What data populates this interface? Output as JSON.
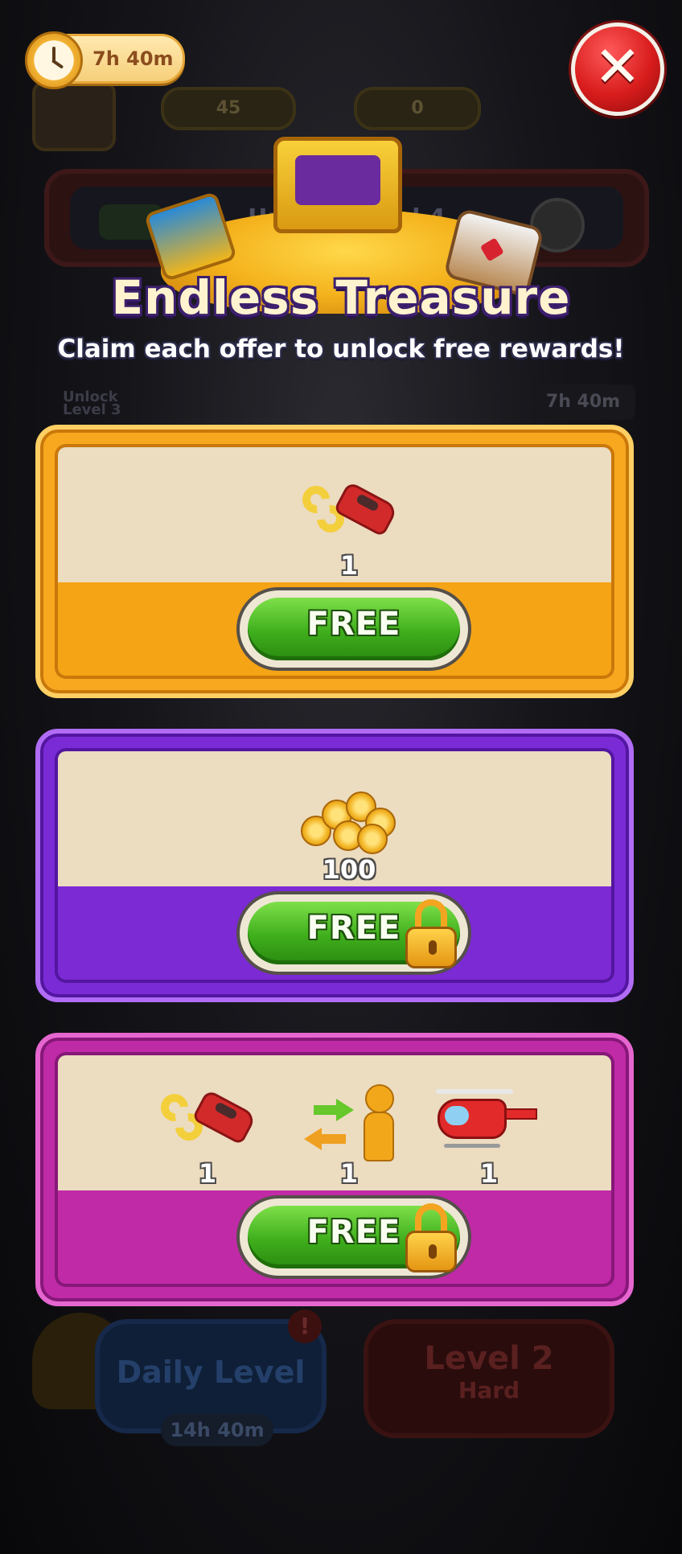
{
  "hud": {
    "timer_text": "7h 40m",
    "close_icon": "close-x-icon"
  },
  "background": {
    "coins": "45",
    "crowns": "0",
    "unlock_level_banner": "Unlock Level 4",
    "unlock_level_small": "Unlock Level 3",
    "event_timer": "7h 40m",
    "daily_level_label": "Daily Level",
    "daily_level_timer": "14h 40m",
    "daily_alert": "!",
    "level_button_title": "Level 2",
    "level_button_difficulty": "Hard"
  },
  "offer": {
    "title": "Endless Treasure",
    "subtitle": "Claim each offer to unlock free rewards!"
  },
  "cards": [
    {
      "theme": "orange",
      "accent": "#f7a81f",
      "locked": false,
      "button_label": "FREE",
      "rewards": [
        {
          "icon": "car-swap-icon",
          "count": "1"
        }
      ]
    },
    {
      "theme": "purple",
      "accent": "#7b2bd6",
      "locked": true,
      "button_label": "FREE",
      "rewards": [
        {
          "icon": "coins-icon",
          "count": "100"
        }
      ]
    },
    {
      "theme": "magenta",
      "accent": "#bf2aa6",
      "locked": true,
      "button_label": "FREE",
      "rewards": [
        {
          "icon": "car-swap-icon",
          "count": "1"
        },
        {
          "icon": "passenger-swap-icon",
          "count": "1"
        },
        {
          "icon": "helicopter-icon",
          "count": "1"
        }
      ]
    }
  ]
}
